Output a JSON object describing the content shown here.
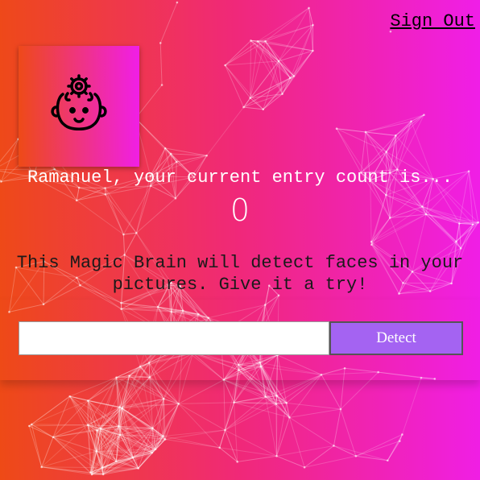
{
  "nav": {
    "sign_out_label": "Sign Out"
  },
  "logo": {
    "icon": "brain-head-icon"
  },
  "rank": {
    "user_name": "Ramanuel",
    "message": "Ramanuel, your current entry count is...",
    "count": "0"
  },
  "intro": {
    "line1": "This Magic Brain will detect faces in your",
    "line2": "pictures. Give it a try!"
  },
  "form": {
    "input_value": "",
    "input_placeholder": "",
    "detect_label": "Detect"
  },
  "colors": {
    "gradient_start": "#ee4a16",
    "gradient_end": "#f01ee8",
    "button": "#a463f2"
  }
}
